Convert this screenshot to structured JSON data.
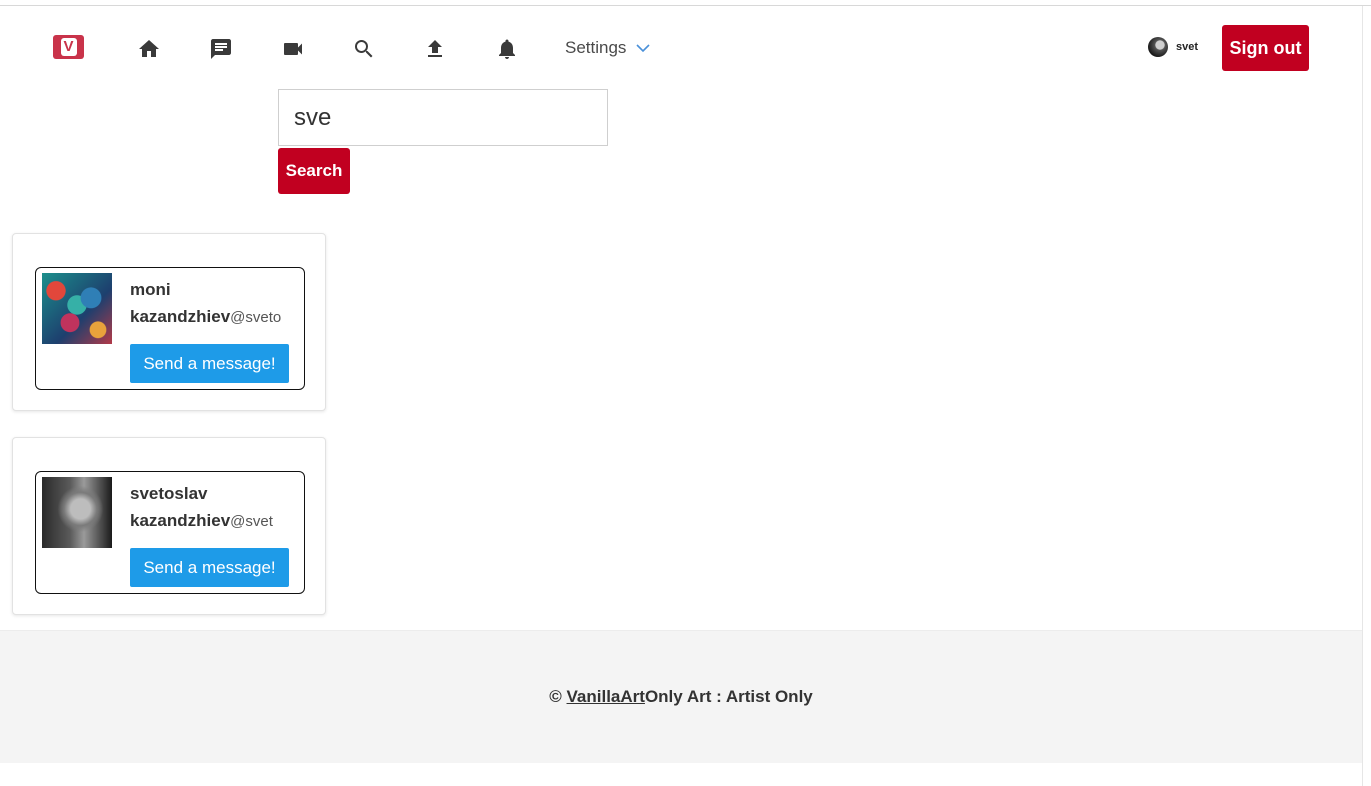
{
  "nav": {
    "logo_letter": "V",
    "icons": [
      "home-icon",
      "chat-icon",
      "video-icon",
      "search-icon",
      "upload-icon",
      "bell-icon"
    ],
    "settings_label": "Settings",
    "user_name": "svet",
    "signout_label": "Sign out"
  },
  "search": {
    "value": "sve",
    "button_label": "Search"
  },
  "results": [
    {
      "name": "moni kazandzhiev",
      "handle": "@sveto",
      "button_label": "Send a message!"
    },
    {
      "name": "svetoslav kazandzhiev",
      "handle": "@svet",
      "button_label": "Send a message!"
    }
  ],
  "footer": {
    "copyright": "©",
    "brand_link": "VanillaArt ",
    "tagline": "Only Art : Artist Only"
  },
  "colors": {
    "brand_red": "#c10020",
    "message_blue": "#1e9be8",
    "logo_red": "#c9334a"
  }
}
